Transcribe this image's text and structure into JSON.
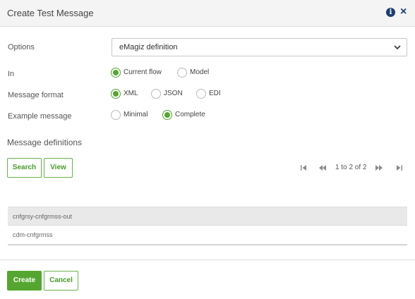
{
  "dialog": {
    "title": "Create Test Message",
    "info_icon": "i",
    "close_icon": "×"
  },
  "form": {
    "options_label": "Options",
    "options_value": "eMagiz definition",
    "in_label": "In",
    "in_options": [
      "Current flow",
      "Model"
    ],
    "in_selected": "Current flow",
    "format_label": "Message format",
    "format_options": [
      "XML",
      "JSON",
      "EDI"
    ],
    "format_selected": "XML",
    "example_label": "Example message",
    "example_options": [
      "Minimal",
      "Complete"
    ],
    "example_selected": "Complete"
  },
  "definitions": {
    "title": "Message definitions",
    "search_label": "Search",
    "view_label": "View",
    "pager_text": "1 to 2 of 2",
    "rows": [
      "cnfgrsy-cnfgrmss-out",
      "cdm-cnfgrmss"
    ]
  },
  "footer": {
    "create_label": "Create",
    "cancel_label": "Cancel"
  },
  "colors": {
    "accent": "#55a630",
    "header_bg": "#f4f4f4",
    "icon_blue": "#1d3d73"
  }
}
